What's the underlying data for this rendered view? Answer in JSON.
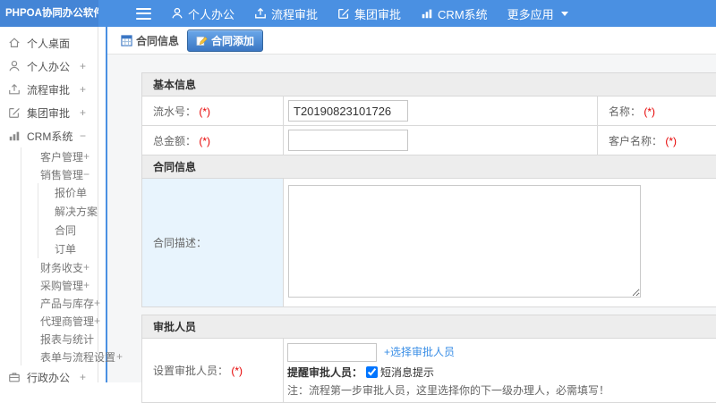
{
  "topbar": {
    "logo": "PHPOA协同办公软件",
    "nav": [
      {
        "label": "个人办公",
        "icon": "user-icon"
      },
      {
        "label": "流程审批",
        "icon": "process-icon"
      },
      {
        "label": "集团审批",
        "icon": "edit-icon"
      },
      {
        "label": "CRM系统",
        "icon": "chart-icon"
      },
      {
        "label": "更多应用",
        "icon": "caret-down-icon"
      }
    ],
    "menu_icon": "hamburger-icon"
  },
  "sidebar": {
    "items": [
      {
        "label": "个人桌面",
        "icon": "home-icon",
        "expander": ""
      },
      {
        "label": "个人办公",
        "icon": "user-icon",
        "expander": "+"
      },
      {
        "label": "流程审批",
        "icon": "process-icon",
        "expander": "+"
      },
      {
        "label": "集团审批",
        "icon": "edit-icon",
        "expander": "+"
      },
      {
        "label": "CRM系统",
        "icon": "chart-icon",
        "expander": "−"
      },
      {
        "label": "客户管理",
        "expander": "+"
      },
      {
        "label": "销售管理",
        "expander": "−"
      },
      {
        "label": "报价单",
        "expander": ""
      },
      {
        "label": "解决方案",
        "expander": ""
      },
      {
        "label": "合同",
        "expander": ""
      },
      {
        "label": "订单",
        "expander": ""
      },
      {
        "label": "财务收支",
        "expander": "+"
      },
      {
        "label": "采购管理",
        "expander": "+"
      },
      {
        "label": "产品与库存",
        "expander": "+"
      },
      {
        "label": "代理商管理",
        "expander": "+"
      },
      {
        "label": "报表与统计",
        "expander": ""
      },
      {
        "label": "表单与流程设置",
        "expander": "+"
      },
      {
        "label": "行政办公",
        "icon": "office-icon",
        "expander": "+"
      }
    ]
  },
  "tabs": {
    "info": "合同信息",
    "add": "合同添加"
  },
  "form": {
    "required": "(*)",
    "basic_title": "基本信息",
    "serial_label": "流水号：",
    "serial_value": "T20190823101726",
    "name_label": "名称：",
    "amount_label": "总金额：",
    "customer_label": "客户名称：",
    "contract_title": "合同信息",
    "desc_label": "合同描述：",
    "approver_title": "审批人员",
    "approver_label": "设置审批人员：",
    "choose_link": "+选择审批人员",
    "remind_label": "提醒审批人员：",
    "sms_label": "短消息提示",
    "sms_checked": "checked",
    "note": "注：流程第一步审批人员，这里选择你的下一级办理人，必需填写！"
  },
  "colors": {
    "topbar_blue": "#4a90e2",
    "logo_blue": "#4485d6",
    "link_blue": "#3a8ee6",
    "required_red": "#e60000",
    "section_header_bg": "#ededed",
    "desc_label_bg": "#e8f4fd"
  }
}
